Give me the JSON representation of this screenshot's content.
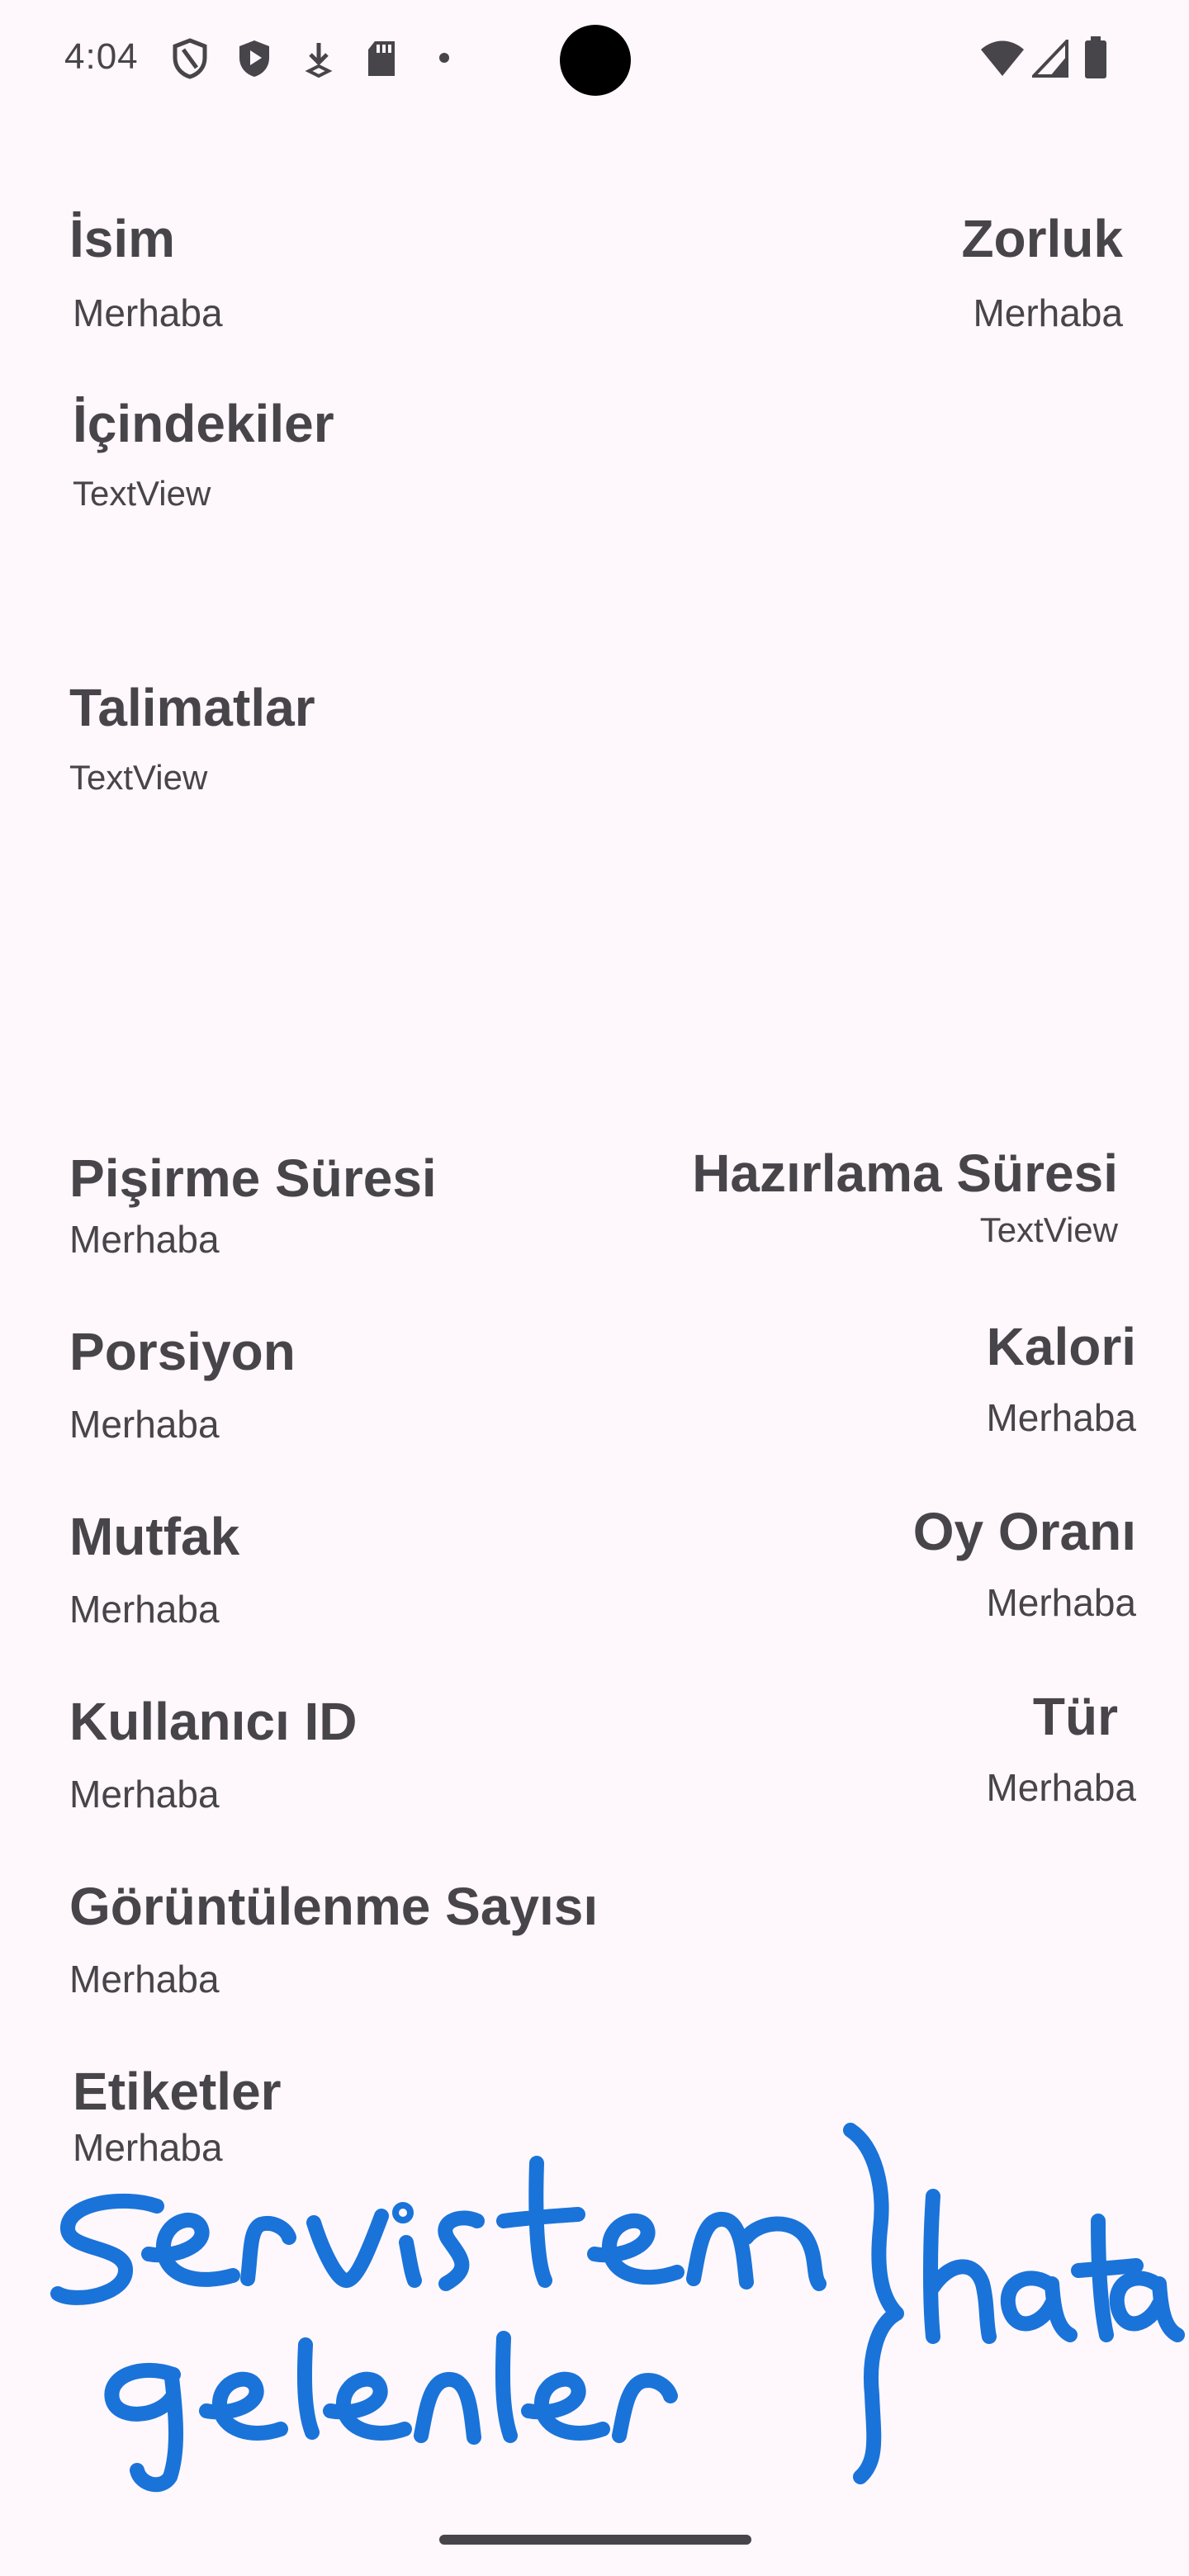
{
  "status_bar": {
    "time": "4:04",
    "left_icons": [
      "shield-outline-icon",
      "shield-play-icon",
      "download-icon",
      "sd-card-icon",
      "dot-icon"
    ],
    "right_icons": [
      "wifi-icon",
      "signal-icon",
      "battery-icon"
    ]
  },
  "fields": {
    "name": {
      "label": "İsim",
      "value": "Merhaba"
    },
    "difficulty": {
      "label": "Zorluk",
      "value": "Merhaba"
    },
    "ingredients": {
      "label": "İçindekiler",
      "value": "TextView"
    },
    "instructions": {
      "label": "Talimatlar",
      "value": "TextView"
    },
    "cook_time": {
      "label": "Pişirme Süresi",
      "value": "Merhaba"
    },
    "prep_time": {
      "label": "Hazırlama Süresi",
      "value": "TextView"
    },
    "servings": {
      "label": "Porsiyon",
      "value": "Merhaba"
    },
    "calories": {
      "label": "Kalori",
      "value": "Merhaba"
    },
    "cuisine": {
      "label": "Mutfak",
      "value": "Merhaba"
    },
    "rating": {
      "label": "Oy Oranı",
      "value": "Merhaba"
    },
    "user_id": {
      "label": "Kullanıcı ID",
      "value": "Merhaba"
    },
    "type": {
      "label": "Tür",
      "value": "Merhaba"
    },
    "view_count": {
      "label": "Görüntülenme Sayısı",
      "value": "Merhaba"
    },
    "tags": {
      "label": "Etiketler",
      "value": "Merhaba"
    }
  },
  "annotation": {
    "handwritten_text": "servisten gelenler } hata",
    "color": "#1A73D9"
  },
  "colors": {
    "background": "#FEF7FC",
    "text": "#47454A"
  }
}
